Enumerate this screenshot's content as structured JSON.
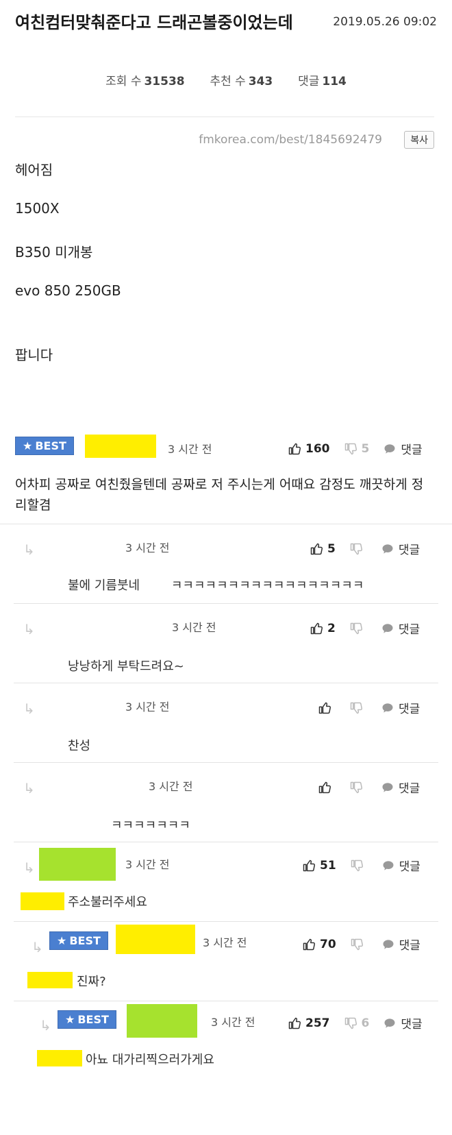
{
  "post": {
    "title": "여친컴터맞춰준다고 드래곤볼중이었는데",
    "date": "2019.05.26 09:02",
    "views_label": "조회 수",
    "views": "31538",
    "likes_label": "추천 수",
    "likes": "343",
    "comments_label": "댓글",
    "comments": "114",
    "url": "fmkorea.com/best/1845692479",
    "copy_label": "복사",
    "lines": [
      "헤어짐",
      "1500X",
      "B350 미개봉",
      "evo 850 250GB",
      "팝니다"
    ]
  },
  "comment_ui": {
    "best_label": "BEST",
    "reply_label": "댓글"
  },
  "comments": [
    {
      "time": "3 시간 전",
      "up": "160",
      "down": "5",
      "text": "어차피 공짜로 여친줬을텐데 공짜로 저 주시는게 어때요 감정도 깨끗하게 정리할겸"
    },
    {
      "time": "3 시간 전",
      "up": "5",
      "down": "",
      "text": "불에 기름붓네        ㅋㅋㅋㅋㅋㅋㅋㅋㅋㅋㅋㅋㅋㅋㅋㅋㅋ"
    },
    {
      "time": "3 시간 전",
      "up": "2",
      "down": "",
      "text": "낭낭하게 부탁드려요~"
    },
    {
      "time": "3 시간 전",
      "up": "",
      "down": "",
      "text": "찬성"
    },
    {
      "time": "3 시간 전",
      "up": "",
      "down": "",
      "text": "ㅋㅋㅋㅋㅋㅋㅋ"
    },
    {
      "time": "3 시간 전",
      "up": "51",
      "down": "",
      "text": "주소불러주세요"
    },
    {
      "time": "3 시간 전",
      "up": "70",
      "down": "",
      "text": "진짜?"
    },
    {
      "time": "3 시간 전",
      "up": "257",
      "down": "6",
      "text": "아뇨 대가리찍으러가게요"
    }
  ]
}
